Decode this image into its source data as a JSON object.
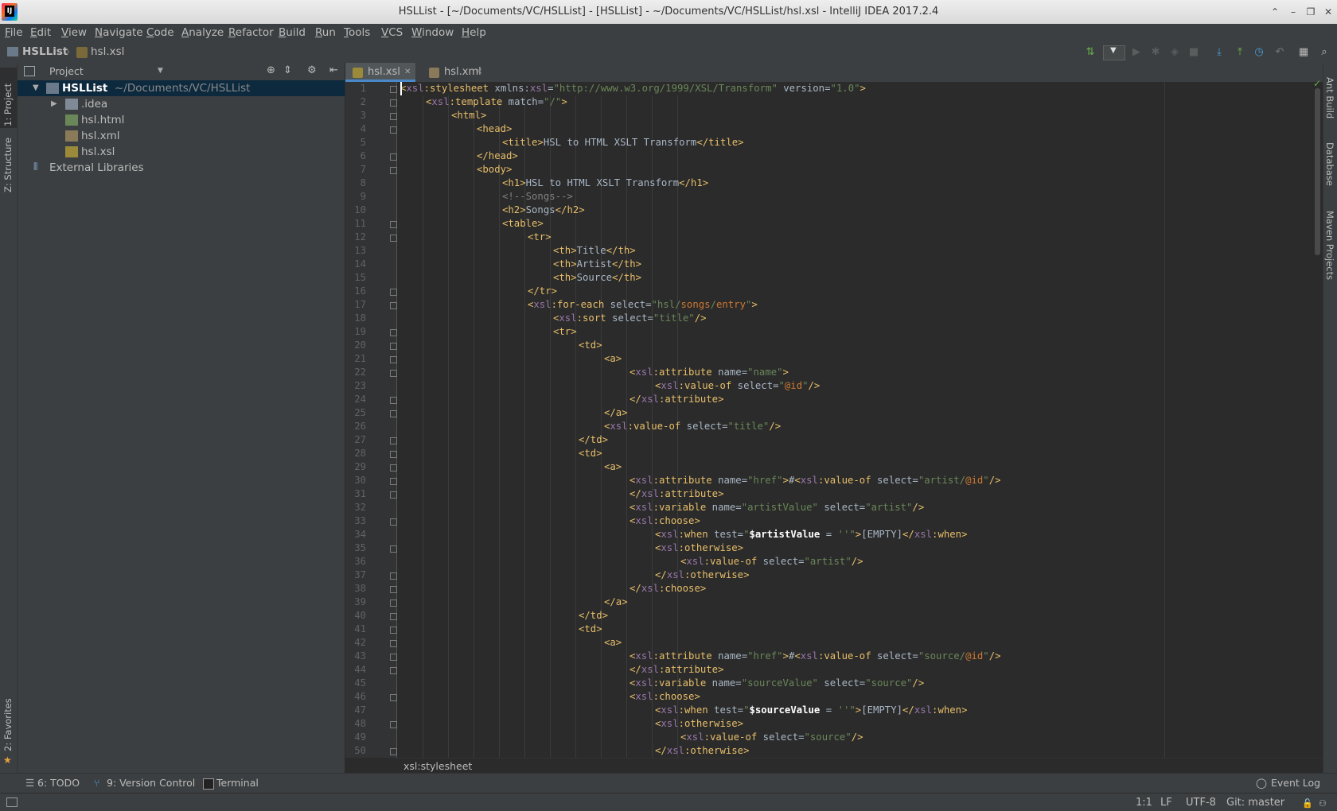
{
  "window": {
    "title": "HSLList - [~/Documents/VC/HSLList] - [HSLList] - ~/Documents/VC/HSLList/hsl.xsl - IntelliJ IDEA 2017.2.4",
    "logo_text": "IJ"
  },
  "menu": [
    "File",
    "Edit",
    "View",
    "Navigate",
    "Code",
    "Analyze",
    "Refactor",
    "Build",
    "Run",
    "Tools",
    "VCS",
    "Window",
    "Help"
  ],
  "navbar": {
    "project": "HSLList",
    "file": "hsl.xsl"
  },
  "left_tabs": {
    "project": "1: Project",
    "structure": "Z: Structure",
    "favorites": "2: Favorites"
  },
  "right_tabs": {
    "ant": "Ant Build",
    "database": "Database",
    "maven": "Maven Projects"
  },
  "project_panel": {
    "title": "Project",
    "root": {
      "name": "HSLList",
      "path": "~/Documents/VC/HSLList"
    },
    "items": [
      ".idea",
      "hsl.html",
      "hsl.xml",
      "hsl.xsl"
    ],
    "external": "External Libraries"
  },
  "editor_tabs": [
    "hsl.xsl",
    "hsl.xml"
  ],
  "breadcrumb": "xsl:stylesheet",
  "code_lines": [
    {
      "i": 0,
      "h": "<span class=\"tg\">&lt;</span><span class=\"ns\">xsl</span><span class=\"tg\">:stylesheet</span> <span class=\"tx\">xmlns:</span><span class=\"ns\">xsl</span><span class=\"tx\">=</span><span class=\"av\">\"http://www.w3.org/1999/XSL/Transform\"</span> <span class=\"tx\">version=</span><span class=\"av\">\"1.0\"</span><span class=\"tg\">&gt;</span>"
    },
    {
      "i": 1,
      "h": "<span class=\"tg\">&lt;</span><span class=\"ns\">xsl</span><span class=\"tg\">:template</span> <span class=\"tx\">match=</span><span class=\"av\">\"/\"</span><span class=\"tg\">&gt;</span>"
    },
    {
      "i": 2,
      "h": "<span class=\"tg\">&lt;html&gt;</span>"
    },
    {
      "i": 3,
      "h": "<span class=\"tg\">&lt;head&gt;</span>"
    },
    {
      "i": 4,
      "h": "<span class=\"tg\">&lt;title&gt;</span>HSL to HTML XSLT Transform<span class=\"tg\">&lt;/title&gt;</span>"
    },
    {
      "i": 3,
      "h": "<span class=\"tg\">&lt;/head&gt;</span>"
    },
    {
      "i": 3,
      "h": "<span class=\"tg\">&lt;body&gt;</span>"
    },
    {
      "i": 4,
      "h": "<span class=\"tg\">&lt;h1&gt;</span>HSL to HTML XSLT Transform<span class=\"tg\">&lt;/h1&gt;</span>"
    },
    {
      "i": 4,
      "h": "<span class=\"cm\">&lt;!--Songs--&gt;</span>"
    },
    {
      "i": 4,
      "h": "<span class=\"tg\">&lt;h2&gt;</span>Songs<span class=\"tg\">&lt;/h2&gt;</span>"
    },
    {
      "i": 4,
      "h": "<span class=\"tg\">&lt;table&gt;</span>"
    },
    {
      "i": 5,
      "h": "<span class=\"tg\">&lt;tr&gt;</span>"
    },
    {
      "i": 6,
      "h": "<span class=\"tg\">&lt;th&gt;</span>Title<span class=\"tg\">&lt;/th&gt;</span>"
    },
    {
      "i": 6,
      "h": "<span class=\"tg\">&lt;th&gt;</span>Artist<span class=\"tg\">&lt;/th&gt;</span>"
    },
    {
      "i": 6,
      "h": "<span class=\"tg\">&lt;th&gt;</span>Source<span class=\"tg\">&lt;/th&gt;</span>"
    },
    {
      "i": 5,
      "h": "<span class=\"tg\">&lt;/tr&gt;</span>"
    },
    {
      "i": 5,
      "h": "<span class=\"tg\">&lt;</span><span class=\"ns\">xsl</span><span class=\"tg\">:for-each</span> <span class=\"tx\">select=</span><span class=\"av\">\"hsl/</span><span class=\"xp\">songs</span><span class=\"av\">/</span><span class=\"xp\">entry</span><span class=\"av\">\"</span><span class=\"tg\">&gt;</span>"
    },
    {
      "i": 6,
      "h": "<span class=\"tg\">&lt;</span><span class=\"ns\">xsl</span><span class=\"tg\">:sort</span> <span class=\"tx\">select=</span><span class=\"av\">\"title\"</span><span class=\"tg\">/&gt;</span>"
    },
    {
      "i": 6,
      "h": "<span class=\"tg\">&lt;tr&gt;</span>"
    },
    {
      "i": 7,
      "h": "<span class=\"tg\">&lt;td&gt;</span>"
    },
    {
      "i": 8,
      "h": "<span class=\"tg\">&lt;a&gt;</span>"
    },
    {
      "i": 9,
      "h": "<span class=\"tg\">&lt;</span><span class=\"ns\">xsl</span><span class=\"tg\">:attribute</span> <span class=\"tx\">name=</span><span class=\"av\">\"name\"</span><span class=\"tg\">&gt;</span>"
    },
    {
      "i": 10,
      "h": "<span class=\"tg\">&lt;</span><span class=\"ns\">xsl</span><span class=\"tg\">:value-of</span> <span class=\"tx\">select=</span><span class=\"av\">\"</span><span class=\"xp\">@id</span><span class=\"av\">\"</span><span class=\"tg\">/&gt;</span>"
    },
    {
      "i": 9,
      "h": "<span class=\"tg\">&lt;/</span><span class=\"ns\">xsl</span><span class=\"tg\">:attribute&gt;</span>"
    },
    {
      "i": 8,
      "h": "<span class=\"tg\">&lt;/a&gt;</span>"
    },
    {
      "i": 8,
      "h": "<span class=\"tg\">&lt;</span><span class=\"ns\">xsl</span><span class=\"tg\">:value-of</span> <span class=\"tx\">select=</span><span class=\"av\">\"title\"</span><span class=\"tg\">/&gt;</span>"
    },
    {
      "i": 7,
      "h": "<span class=\"tg\">&lt;/td&gt;</span>"
    },
    {
      "i": 7,
      "h": "<span class=\"tg\">&lt;td&gt;</span>"
    },
    {
      "i": 8,
      "h": "<span class=\"tg\">&lt;a&gt;</span>"
    },
    {
      "i": 9,
      "h": "<span class=\"tg\">&lt;</span><span class=\"ns\">xsl</span><span class=\"tg\">:attribute</span> <span class=\"tx\">name=</span><span class=\"av\">\"href\"</span><span class=\"tg\">&gt;</span>#<span class=\"tg\">&lt;</span><span class=\"ns\">xsl</span><span class=\"tg\">:value-of</span> <span class=\"tx\">select=</span><span class=\"av\">\"artist/</span><span class=\"xp\">@id</span><span class=\"av\">\"</span><span class=\"tg\">/&gt;</span>"
    },
    {
      "i": 9,
      "h": "<span class=\"tg\">&lt;/</span><span class=\"ns\">xsl</span><span class=\"tg\">:attribute&gt;</span>"
    },
    {
      "i": 9,
      "h": "<span class=\"tg\">&lt;</span><span class=\"ns\">xsl</span><span class=\"tg\">:variable</span> <span class=\"tx\">name=</span><span class=\"av\">\"artistValue\"</span> <span class=\"tx\">select=</span><span class=\"av\">\"artist\"</span><span class=\"tg\">/&gt;</span>"
    },
    {
      "i": 9,
      "h": "<span class=\"tg\">&lt;</span><span class=\"ns\">xsl</span><span class=\"tg\">:choose&gt;</span>"
    },
    {
      "i": 10,
      "h": "<span class=\"tg\">&lt;</span><span class=\"ns\">xsl</span><span class=\"tg\">:when</span> <span class=\"tx\">test=</span><span class=\"av\">\"</span><span class=\"vr\">$artistValue</span> <span class=\"tx\">=</span> <span class=\"av\">''\"</span><span class=\"tg\">&gt;</span>[EMPTY]<span class=\"tg\">&lt;/</span><span class=\"ns\">xsl</span><span class=\"tg\">:when&gt;</span>"
    },
    {
      "i": 10,
      "h": "<span class=\"tg\">&lt;</span><span class=\"ns\">xsl</span><span class=\"tg\">:otherwise&gt;</span>"
    },
    {
      "i": 11,
      "h": "<span class=\"tg\">&lt;</span><span class=\"ns\">xsl</span><span class=\"tg\">:value-of</span> <span class=\"tx\">select=</span><span class=\"av\">\"artist\"</span><span class=\"tg\">/&gt;</span>"
    },
    {
      "i": 10,
      "h": "<span class=\"tg\">&lt;/</span><span class=\"ns\">xsl</span><span class=\"tg\">:otherwise&gt;</span>"
    },
    {
      "i": 9,
      "h": "<span class=\"tg\">&lt;/</span><span class=\"ns\">xsl</span><span class=\"tg\">:choose&gt;</span>"
    },
    {
      "i": 8,
      "h": "<span class=\"tg\">&lt;/a&gt;</span>"
    },
    {
      "i": 7,
      "h": "<span class=\"tg\">&lt;/td&gt;</span>"
    },
    {
      "i": 7,
      "h": "<span class=\"tg\">&lt;td&gt;</span>"
    },
    {
      "i": 8,
      "h": "<span class=\"tg\">&lt;a&gt;</span>"
    },
    {
      "i": 9,
      "h": "<span class=\"tg\">&lt;</span><span class=\"ns\">xsl</span><span class=\"tg\">:attribute</span> <span class=\"tx\">name=</span><span class=\"av\">\"href\"</span><span class=\"tg\">&gt;</span>#<span class=\"tg\">&lt;</span><span class=\"ns\">xsl</span><span class=\"tg\">:value-of</span> <span class=\"tx\">select=</span><span class=\"av\">\"source/</span><span class=\"xp\">@id</span><span class=\"av\">\"</span><span class=\"tg\">/&gt;</span>"
    },
    {
      "i": 9,
      "h": "<span class=\"tg\">&lt;/</span><span class=\"ns\">xsl</span><span class=\"tg\">:attribute&gt;</span>"
    },
    {
      "i": 9,
      "h": "<span class=\"tg\">&lt;</span><span class=\"ns\">xsl</span><span class=\"tg\">:variable</span> <span class=\"tx\">name=</span><span class=\"av\">\"sourceValue\"</span> <span class=\"tx\">select=</span><span class=\"av\">\"source\"</span><span class=\"tg\">/&gt;</span>"
    },
    {
      "i": 9,
      "h": "<span class=\"tg\">&lt;</span><span class=\"ns\">xsl</span><span class=\"tg\">:choose&gt;</span>"
    },
    {
      "i": 10,
      "h": "<span class=\"tg\">&lt;</span><span class=\"ns\">xsl</span><span class=\"tg\">:when</span> <span class=\"tx\">test=</span><span class=\"av\">\"</span><span class=\"vr\">$sourceValue</span> <span class=\"tx\">=</span> <span class=\"av\">''\"</span><span class=\"tg\">&gt;</span>[EMPTY]<span class=\"tg\">&lt;/</span><span class=\"ns\">xsl</span><span class=\"tg\">:when&gt;</span>"
    },
    {
      "i": 10,
      "h": "<span class=\"tg\">&lt;</span><span class=\"ns\">xsl</span><span class=\"tg\">:otherwise&gt;</span>"
    },
    {
      "i": 11,
      "h": "<span class=\"tg\">&lt;</span><span class=\"ns\">xsl</span><span class=\"tg\">:value-of</span> <span class=\"tx\">select=</span><span class=\"av\">\"source\"</span><span class=\"tg\">/&gt;</span>"
    },
    {
      "i": 10,
      "h": "<span class=\"tg\">&lt;/</span><span class=\"ns\">xsl</span><span class=\"tg\">:otherwise&gt;</span>"
    }
  ],
  "bottom_tools": {
    "todo": "6: TODO",
    "vcs": "9: Version Control",
    "terminal": "Terminal",
    "event_log": "Event Log"
  },
  "status": {
    "position": "1:1",
    "line_sep": "LF",
    "encoding": "UTF-8",
    "git": "Git: master"
  },
  "colors": {
    "tag": "#e8bf6a",
    "namespace": "#9876aa",
    "attr_value": "#6a8759",
    "comment": "#808080",
    "selection": "#0d293e"
  }
}
